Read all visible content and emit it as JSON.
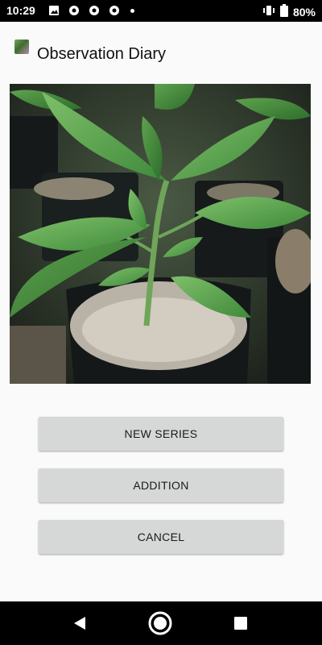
{
  "status_bar": {
    "time": "10:29",
    "battery": "80%",
    "icons": [
      "image-icon",
      "chrome-icon",
      "chrome-icon",
      "chrome-icon",
      "dot-icon",
      "vibrate-icon",
      "battery-icon"
    ]
  },
  "app_bar": {
    "title": "Observation Diary",
    "icon": "app-logo-icon"
  },
  "photo": {
    "subject": "pepper-seedling-photo"
  },
  "buttons": {
    "new_series": "NEW SERIES",
    "addition": "ADDITION",
    "cancel": "CANCEL"
  },
  "nav_bar": {
    "icons": [
      "back-icon",
      "home-icon",
      "recents-icon"
    ]
  },
  "colors": {
    "button_bg": "#d6d7d7",
    "background": "#fafafa",
    "bars": "#000000"
  }
}
